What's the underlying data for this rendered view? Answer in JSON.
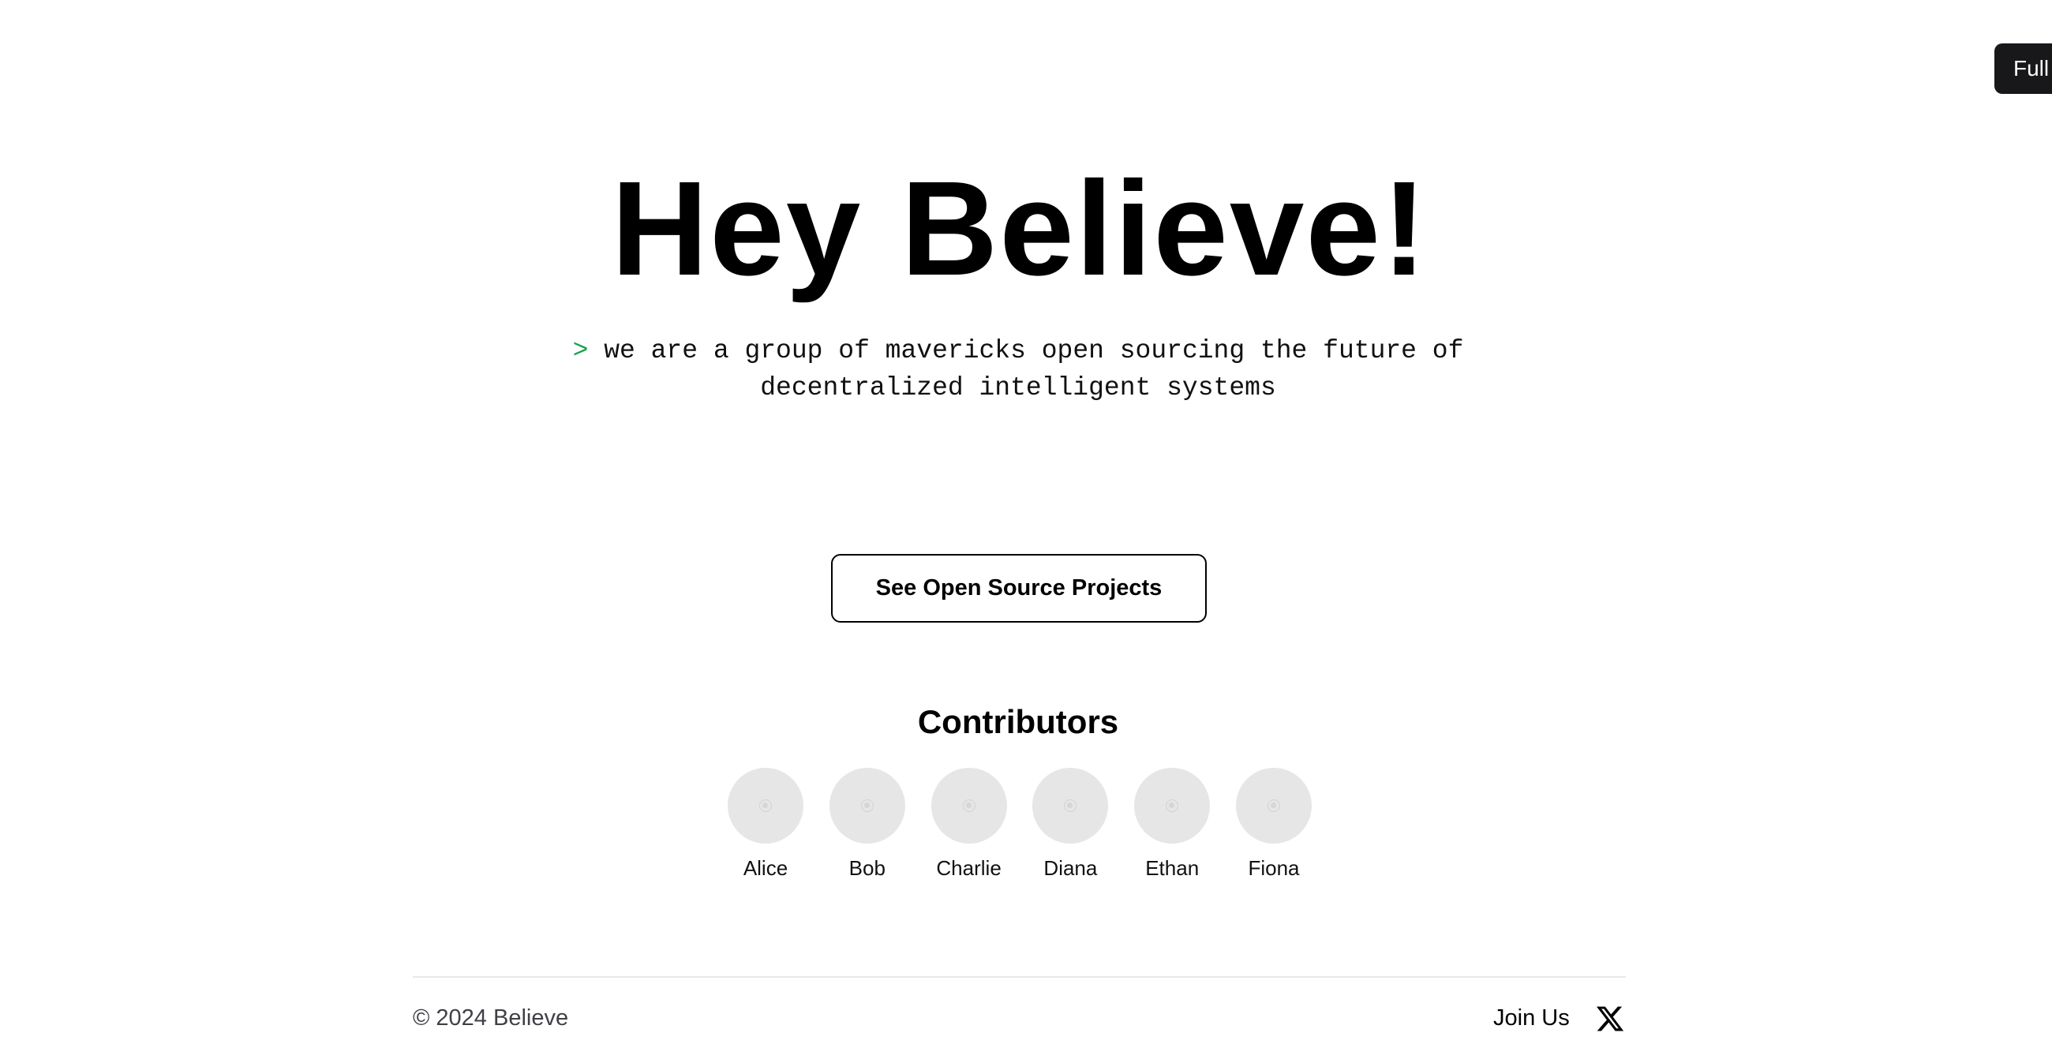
{
  "corner": {
    "label": "Full"
  },
  "hero": {
    "title": "Hey Believe!",
    "prompt": ">",
    "tagline": "we are a group of mavericks open sourcing the future of decentralized intelligent systems"
  },
  "cta": {
    "label": "See Open Source Projects"
  },
  "contributors": {
    "heading": "Contributors",
    "people": [
      {
        "name": "Alice"
      },
      {
        "name": "Bob"
      },
      {
        "name": "Charlie"
      },
      {
        "name": "Diana"
      },
      {
        "name": "Ethan"
      },
      {
        "name": "Fiona"
      }
    ]
  },
  "footer": {
    "copyright": "© 2024 Believe",
    "join_label": "Join Us",
    "social_icon": "x-logo-icon"
  },
  "colors": {
    "background": "#ffffff",
    "text": "#000000",
    "prompt": "#16a34a",
    "avatar_placeholder": "#e6e6e6",
    "footer_text": "#3f3f46",
    "top_pill": "#18181b"
  }
}
